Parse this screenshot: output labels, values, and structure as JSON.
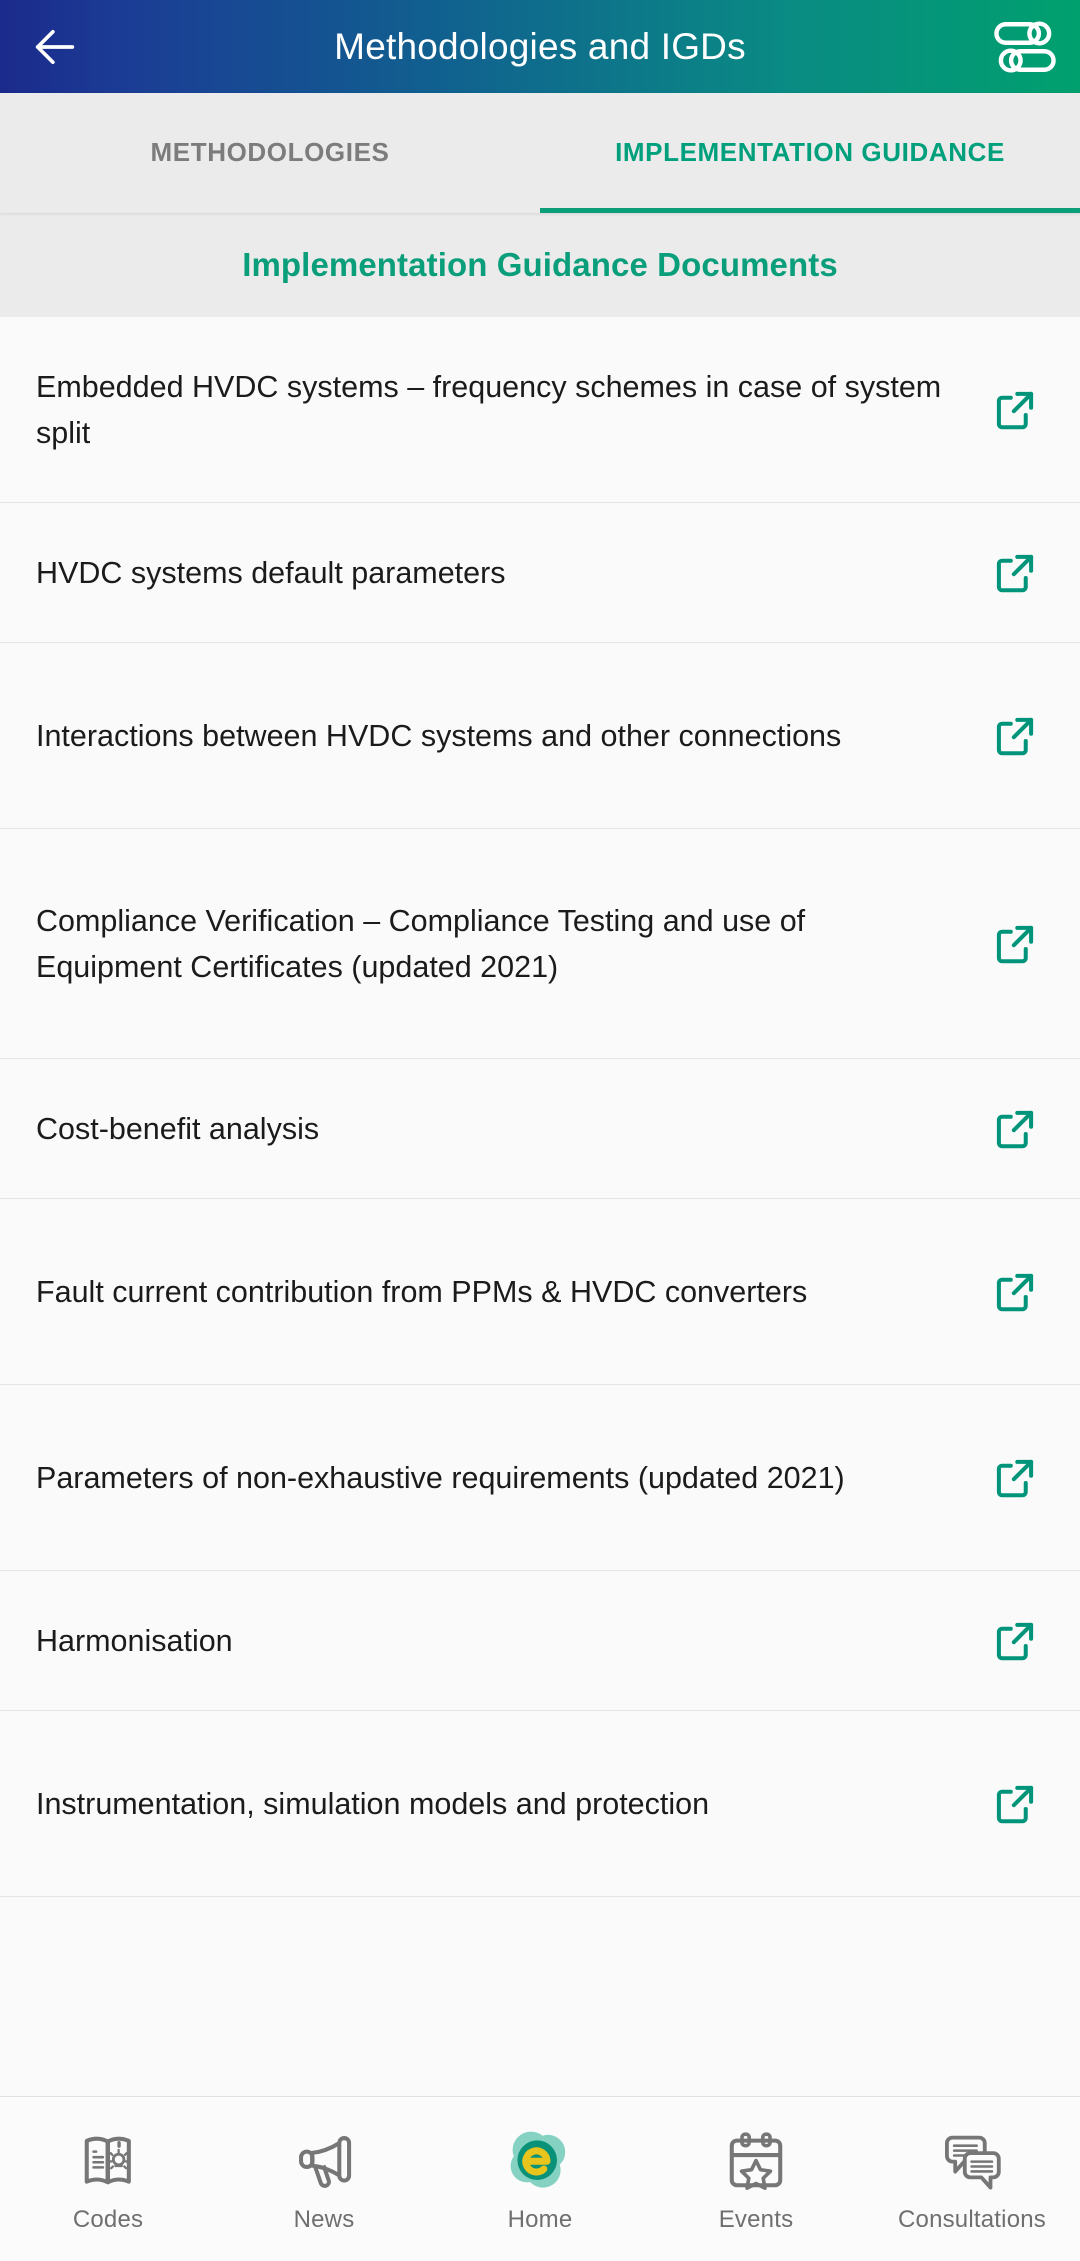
{
  "appbar": {
    "title": "Methodologies and IGDs",
    "back_icon": "arrow-left-icon",
    "action_icon": "tune-sliders-icon"
  },
  "tabs": [
    {
      "label": "METHODOLOGIES",
      "active": false
    },
    {
      "label": "IMPLEMENTATION GUIDANCE",
      "active": true
    }
  ],
  "section": {
    "title": "Implementation Guidance Documents"
  },
  "documents": [
    {
      "title": "Embedded HVDC systems – frequency schemes in case of system split",
      "lines": 2,
      "icon": "external-link-icon"
    },
    {
      "title": "HVDC systems default parameters",
      "lines": 1,
      "icon": "external-link-icon"
    },
    {
      "title": "Interactions between HVDC systems and other connections",
      "lines": 2,
      "icon": "external-link-icon"
    },
    {
      "title": "Compliance Verification – Compliance Testing and use of Equipment Certificates (updated 2021)",
      "lines": 3,
      "icon": "external-link-icon"
    },
    {
      "title": "Cost-benefit analysis",
      "lines": 1,
      "icon": "external-link-icon"
    },
    {
      "title": "Fault current contribution from PPMs & HVDC converters",
      "lines": 2,
      "icon": "external-link-icon"
    },
    {
      "title": "Parameters of non-exhaustive requirements (updated 2021)",
      "lines": 2,
      "icon": "external-link-icon"
    },
    {
      "title": "Harmonisation",
      "lines": 1,
      "icon": "external-link-icon"
    },
    {
      "title": "Instrumentation, simulation models and protection",
      "lines": 2,
      "icon": "external-link-icon"
    }
  ],
  "bottom_nav": [
    {
      "label": "Codes",
      "icon": "book-lightbulb-icon",
      "active": false
    },
    {
      "label": "News",
      "icon": "megaphone-icon",
      "active": false
    },
    {
      "label": "Home",
      "icon": "entsoe-logo-icon",
      "active": false
    },
    {
      "label": "Events",
      "icon": "calendar-star-icon",
      "active": false
    },
    {
      "label": "Consultations",
      "icon": "chat-bubbles-icon",
      "active": false
    }
  ],
  "colors": {
    "accent_teal": "#00a07d",
    "appbar_gradient_start": "#1b2a8c",
    "appbar_gradient_end": "#00a06e",
    "tab_inactive": "#7c7c7c",
    "list_bg": "#fafafa",
    "section_bg": "#ebebeb",
    "logo_yellow": "#e8c51d",
    "logo_teal": "#7fcfc0",
    "nav_label": "#6f6f6f"
  }
}
